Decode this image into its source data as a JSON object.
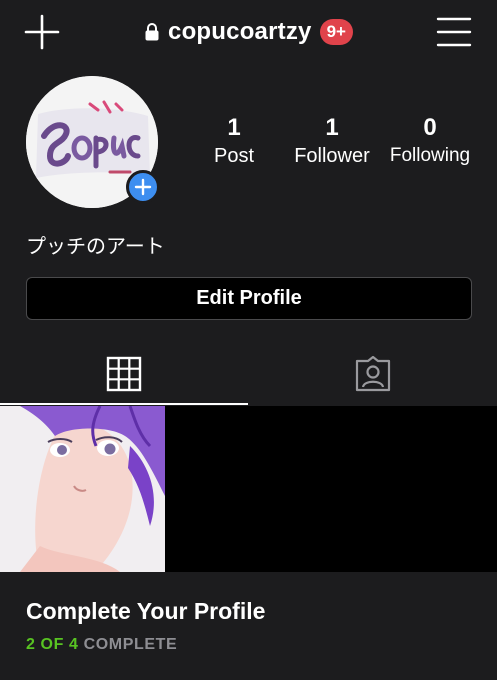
{
  "header": {
    "username": "copucoartzy",
    "notification_badge": "9+",
    "icons": {
      "new_post": "plus-icon",
      "private": "lock-icon",
      "menu": "hamburger-menu-icon"
    }
  },
  "profile": {
    "avatar_icon": "profile-avatar-logo",
    "add_story_icon": "plus-circle-icon",
    "display_name": "プッチのアート",
    "stats": {
      "posts_count": "1",
      "posts_label": "Post",
      "followers_count": "1",
      "followers_label": "Follower",
      "following_count": "0",
      "following_label": "Following"
    }
  },
  "actions": {
    "edit_profile_label": "Edit Profile"
  },
  "tabs": [
    {
      "name": "grid",
      "icon": "grid-icon",
      "active": true
    },
    {
      "name": "tagged",
      "icon": "tagged-person-icon",
      "active": false
    }
  ],
  "posts": [
    {
      "thumbnail": "anime-girl-purple-hair-illustration"
    }
  ],
  "complete_profile": {
    "title": "Complete Your Profile",
    "progress_done": "2 OF 4",
    "progress_label": "COMPLETE"
  },
  "colors": {
    "background": "#1c1c1e",
    "badge": "#e0434b",
    "accent_blue": "#3d8ef0",
    "progress_green": "#58c322"
  }
}
